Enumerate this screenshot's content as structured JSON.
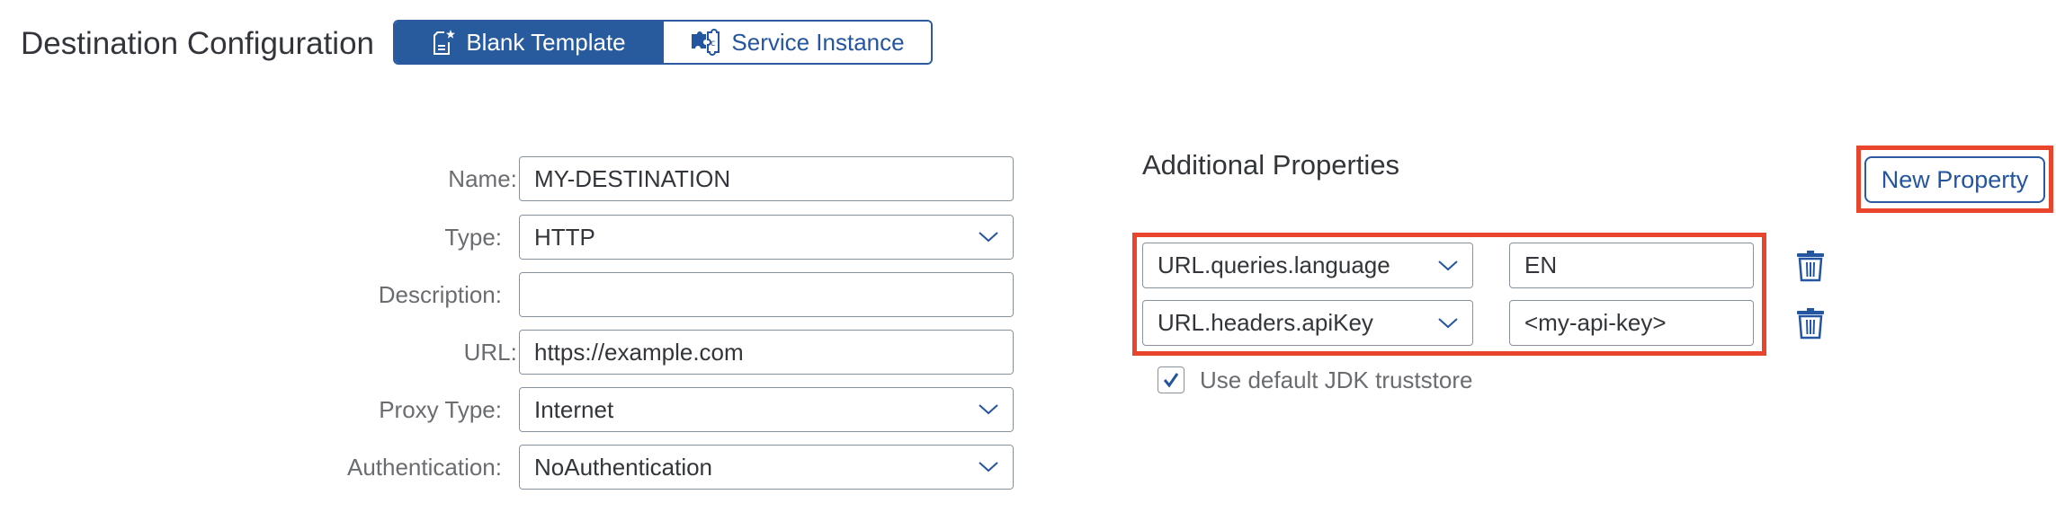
{
  "header": {
    "title": "Destination Configuration",
    "segments": [
      {
        "label": "Blank Template",
        "icon": "blank-template-icon",
        "selected": true
      },
      {
        "label": "Service Instance",
        "icon": "puzzle-icon",
        "selected": false
      }
    ]
  },
  "form": {
    "fields": [
      {
        "label": "Name:",
        "required": true,
        "type": "input",
        "value": "MY-DESTINATION"
      },
      {
        "label": "Type:",
        "required": false,
        "type": "select",
        "value": "HTTP"
      },
      {
        "label": "Description:",
        "required": false,
        "type": "input",
        "value": ""
      },
      {
        "label": "URL:",
        "required": true,
        "type": "input",
        "value": "https://example.com"
      },
      {
        "label": "Proxy Type:",
        "required": false,
        "type": "select",
        "value": "Internet"
      },
      {
        "label": "Authentication:",
        "required": false,
        "type": "select",
        "value": "NoAuthentication"
      }
    ],
    "required_marker": "*"
  },
  "additional_properties": {
    "title": "Additional Properties",
    "new_property_label": "New Property",
    "properties": [
      {
        "key": "URL.queries.language",
        "value": "EN"
      },
      {
        "key": "URL.headers.apiKey",
        "value": "<my-api-key>"
      }
    ],
    "checkbox": {
      "label": "Use default JDK truststore",
      "checked": true
    }
  },
  "colors": {
    "accent": "#285a9e",
    "highlight": "#e8452c",
    "required": "#d0312d",
    "label": "#6a6d70",
    "text": "#32363a",
    "border": "#89919a"
  }
}
